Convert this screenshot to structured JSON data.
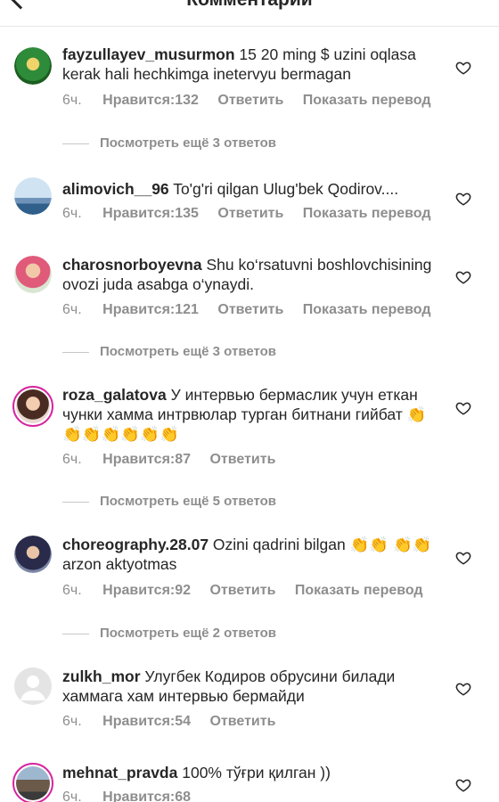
{
  "header": {
    "title": "Комментарии"
  },
  "labels": {
    "likes_prefix": "Нравится: ",
    "reply": "Ответить",
    "translate": "Показать перевод"
  },
  "comments": [
    {
      "username": "fayzullayev_musurmon",
      "text": "15 20 ming $ uzini oqlasa kerak hali hechkimga inetervyu bermagan",
      "time": "6ч.",
      "likes": "132",
      "replies": "Посмотреть ещё 3 ответов"
    },
    {
      "username": "alimovich__96",
      "text": "To'g'ri qilgan Ulug'bek Qodirov....",
      "time": "6ч.",
      "likes": "135"
    },
    {
      "username": "charosnorboyevna",
      "text": "Shu ko‘rsatuvni boshlovchisining ovozi juda asabga o‘ynaydi.",
      "time": "6ч.",
      "likes": "121",
      "replies": "Посмотреть ещё 3 ответов"
    },
    {
      "username": "roza_galatova",
      "text": "У интервью бермаслик учун еткан чунки хамма интрвюлар турган битнани гийбат 👏👏👏👏👏👏👏",
      "time": "6ч.",
      "likes": "87",
      "replies": "Посмотреть ещё 5 ответов"
    },
    {
      "username": "choreography.28.07",
      "text": "Ozini qadrini bilgan 👏👏 👏👏 arzon aktyotmas",
      "time": "6ч.",
      "likes": "92",
      "replies": "Посмотреть ещё 2 ответов"
    },
    {
      "username": "zulkh_mor",
      "text": "Улугбек Кодиров обрусини билади хаммага хам интервью бермайди",
      "time": "6ч.",
      "likes": "54"
    },
    {
      "username": "mehnat_pravda",
      "text": "100% тўғри қилган ))",
      "time": "6ч.",
      "likes": "68"
    }
  ],
  "colors": {
    "text": "#262626",
    "muted": "#8e8e8e",
    "story_ring": "#d6249f"
  }
}
